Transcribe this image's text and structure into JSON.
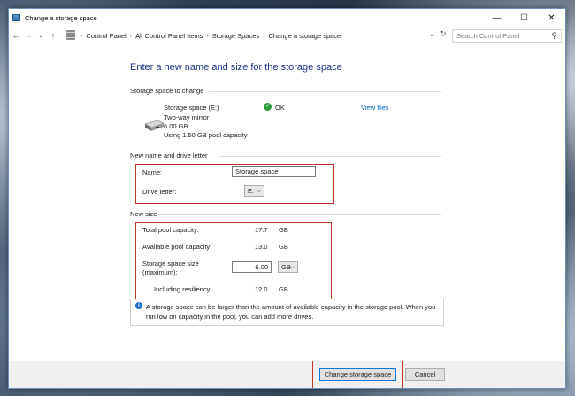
{
  "window": {
    "title": "Change a storage space",
    "controls": {
      "minimize": "—",
      "maximize": "☐",
      "close": "✕"
    }
  },
  "address": {
    "breadcrumbs": [
      "Control Panel",
      "All Control Panel Items",
      "Storage Spaces",
      "Change a storage space"
    ],
    "search_placeholder": "Search Control Panel"
  },
  "page": {
    "heading": "Enter a new name and size for the storage space",
    "section_change": {
      "label": "Storage space to change",
      "name": "Storage space (E:)",
      "resiliency": "Two-way mirror",
      "size": "6.00 GB",
      "usage": "Using 1.50 GB pool capacity",
      "status": "OK",
      "view_files": "View files"
    },
    "section_name": {
      "label": "New name and drive letter",
      "name_label": "Name:",
      "name_value": "Storage space",
      "drive_letter_label": "Drive letter:",
      "drive_letter_value": "E:"
    },
    "section_size": {
      "label": "New size",
      "total_label": "Total pool capacity:",
      "total_value": "17.7",
      "total_unit": "GB",
      "available_label": "Available pool capacity:",
      "available_value": "13.0",
      "available_unit": "GB",
      "size_label_line1": "Storage space size",
      "size_label_line2": "(maximum):",
      "size_value": "6.00",
      "size_unit": "GB",
      "resiliency_label": "Including resiliency:",
      "resiliency_value": "12.0",
      "resiliency_unit": "GB"
    },
    "info": "A storage space can be larger than the amount of available capacity in the storage pool. When you run low on capacity in the pool, you can add more drives."
  },
  "footer": {
    "primary_label": "Change storage space",
    "cancel_label": "Cancel"
  },
  "colors": {
    "heading": "#1e3287",
    "link": "#0066cc",
    "ok": "#2e9e3a",
    "highlight": "#c0392b",
    "accent": "#0078d7"
  }
}
